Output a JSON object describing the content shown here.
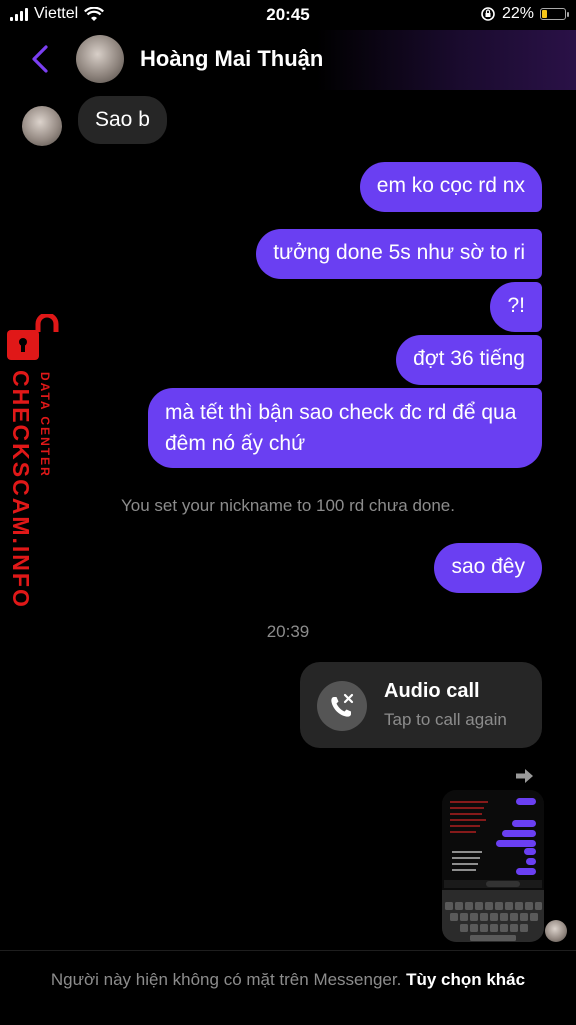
{
  "status_bar": {
    "carrier": "Viettel",
    "time": "20:45",
    "battery_percent": "22%",
    "battery_level": 0.22,
    "battery_color": "#f5c518",
    "icons": [
      "signal-icon",
      "wifi-icon",
      "orientation-lock-icon",
      "battery-icon"
    ]
  },
  "header": {
    "contact_name": "Hoàng Mai Thuận",
    "back_icon": "chevron-left-icon",
    "accent": "#7b3ff2"
  },
  "messages": [
    {
      "side": "in",
      "text": "Sao b"
    },
    {
      "side": "out",
      "text": "em ko cọc rd nx"
    },
    {
      "side": "out",
      "text": "tưởng done 5s như sờ to ri"
    },
    {
      "side": "out",
      "text": "?!"
    },
    {
      "side": "out",
      "text": "đợt 36 tiếng"
    },
    {
      "side": "out",
      "text": "mà tết thì bận sao check đc rd để qua đêm nó ấy chứ"
    },
    {
      "side": "out",
      "text": "sao đêy"
    }
  ],
  "nickname_notice": "You set your nickname to 100 rd chưa done.",
  "timestamp": "20:39",
  "audio_call": {
    "title": "Audio call",
    "subtitle": "Tap to call again",
    "icon": "missed-call-icon"
  },
  "watermark": {
    "main": "CHECKSCAM.INFO",
    "sub": "DATA CENTER",
    "color": "#e01818"
  },
  "footer": {
    "text": "Người này hiện không có mặt trên Messenger.",
    "link": "Tùy chọn khác"
  },
  "colors": {
    "outgoing_bubble": "#6a3ff2",
    "incoming_bubble": "#262626",
    "background": "#000000"
  }
}
